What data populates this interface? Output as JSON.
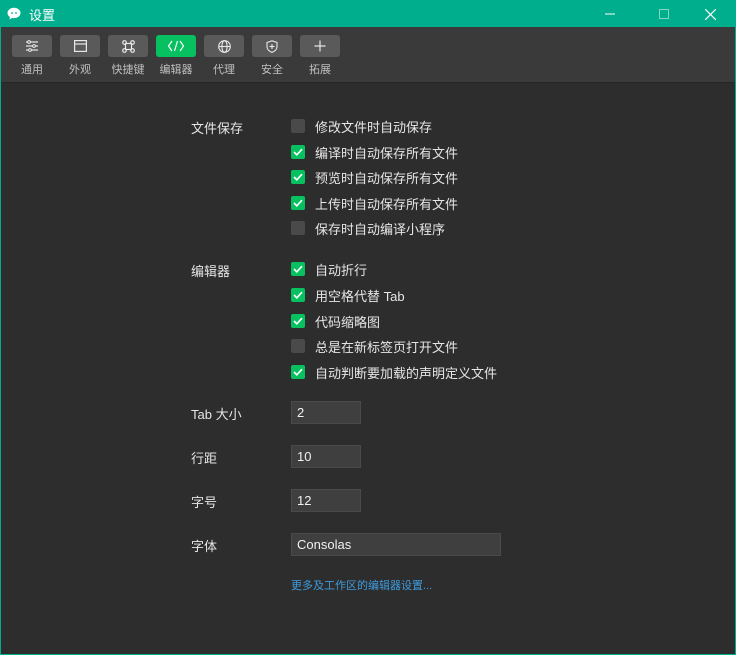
{
  "window": {
    "title": "设置",
    "controls": {
      "minimize": "—",
      "maximize": "☐",
      "close": "✕"
    }
  },
  "toolbar": {
    "items": [
      {
        "label": "通用",
        "icon": "sliders-icon",
        "active": false
      },
      {
        "label": "外观",
        "icon": "window-icon",
        "active": false
      },
      {
        "label": "快捷键",
        "icon": "command-icon",
        "active": false
      },
      {
        "label": "编辑器",
        "icon": "code-icon",
        "active": true
      },
      {
        "label": "代理",
        "icon": "globe-icon",
        "active": false
      },
      {
        "label": "安全",
        "icon": "shield-icon",
        "active": false
      },
      {
        "label": "拓展",
        "icon": "plus-icon",
        "active": false
      }
    ]
  },
  "file_save": {
    "label": "文件保存",
    "options": [
      {
        "label": "修改文件时自动保存",
        "checked": false
      },
      {
        "label": "编译时自动保存所有文件",
        "checked": true
      },
      {
        "label": "预览时自动保存所有文件",
        "checked": true
      },
      {
        "label": "上传时自动保存所有文件",
        "checked": true
      },
      {
        "label": "保存时自动编译小程序",
        "checked": false
      }
    ]
  },
  "editor": {
    "label": "编辑器",
    "options": [
      {
        "label": "自动折行",
        "checked": true
      },
      {
        "label": "用空格代替 Tab",
        "checked": true
      },
      {
        "label": "代码缩略图",
        "checked": true
      },
      {
        "label": "总是在新标签页打开文件",
        "checked": false
      },
      {
        "label": "自动判断要加载的声明定义文件",
        "checked": true
      }
    ]
  },
  "fields": {
    "tab_size": {
      "label": "Tab 大小",
      "value": "2"
    },
    "line_height": {
      "label": "行距",
      "value": "10"
    },
    "font_size": {
      "label": "字号",
      "value": "12"
    },
    "font": {
      "label": "字体",
      "value": "Consolas"
    }
  },
  "more_link": "更多及工作区的编辑器设置...",
  "colors": {
    "accent": "#00ae8e",
    "active": "#07c160",
    "link": "#3d9bdf"
  }
}
